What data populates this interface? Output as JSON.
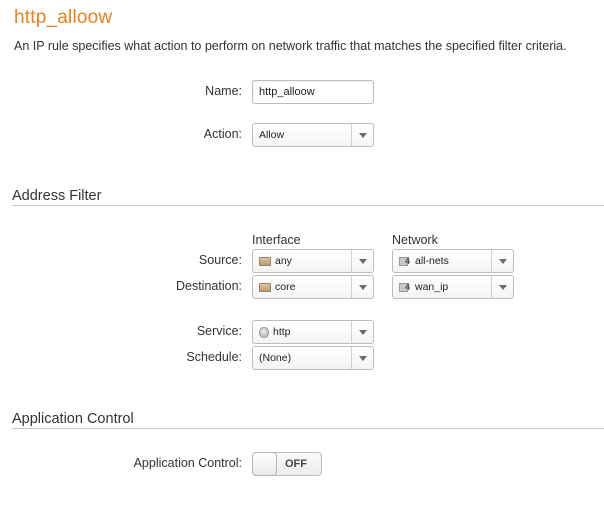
{
  "header": {
    "title": "http_alloow",
    "description": "An IP rule specifies what action to perform on network traffic that matches the specified filter criteria."
  },
  "general": {
    "name_label": "Name:",
    "name_value": "http_alloow",
    "action_label": "Action:",
    "action_value": "Allow"
  },
  "address_filter": {
    "section_title": "Address Filter",
    "col_interface": "Interface",
    "col_network": "Network",
    "source_label": "Source:",
    "source_interface": "any",
    "source_network": "all-nets",
    "destination_label": "Destination:",
    "destination_interface": "core",
    "destination_network": "wan_ip",
    "network_icon_digit": "4",
    "service_label": "Service:",
    "service_value": "http",
    "schedule_label": "Schedule:",
    "schedule_value": "(None)"
  },
  "application_control": {
    "section_title": "Application Control",
    "label": "Application Control:",
    "toggle_state": "OFF"
  },
  "colors": {
    "title_orange": "#e8821e",
    "text": "#333333",
    "border": "#bdbdbd"
  }
}
